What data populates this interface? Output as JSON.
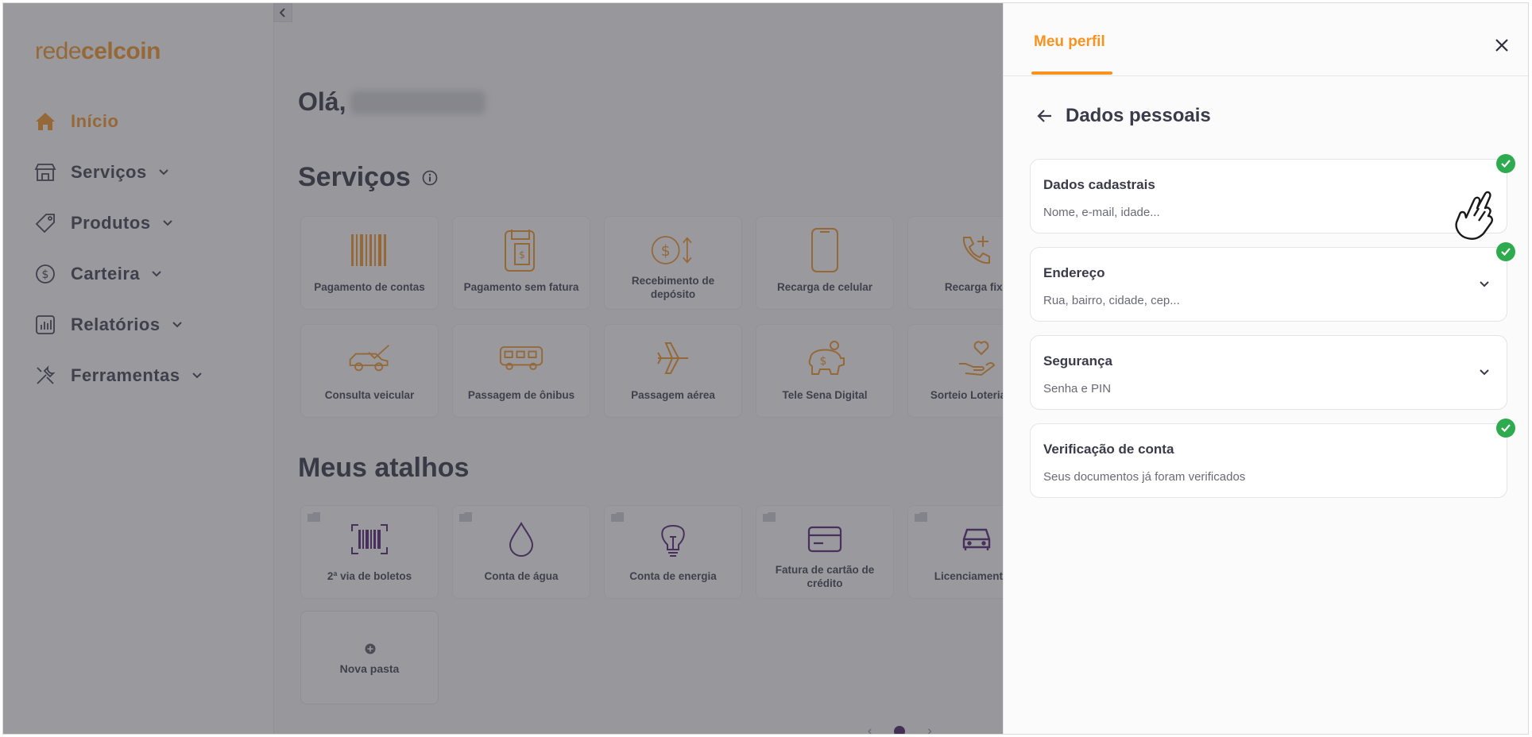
{
  "brand": {
    "logo_light": "rede",
    "logo_bold": "celcoin",
    "accent": "#f7931e"
  },
  "sidebar": {
    "items": [
      {
        "label": "Início",
        "icon": "home-icon",
        "active": true
      },
      {
        "label": "Serviços",
        "icon": "store-icon",
        "expandable": true
      },
      {
        "label": "Produtos",
        "icon": "tag-icon",
        "expandable": true
      },
      {
        "label": "Carteira",
        "icon": "dollar-circle-icon",
        "expandable": true
      },
      {
        "label": "Relatórios",
        "icon": "chart-icon",
        "expandable": true
      },
      {
        "label": "Ferramentas",
        "icon": "tools-icon",
        "expandable": true
      }
    ]
  },
  "main": {
    "greeting": "Olá,",
    "services_title": "Serviços",
    "services": [
      {
        "label": "Pagamento de contas",
        "icon": "barcode-icon"
      },
      {
        "label": "Pagamento sem fatura",
        "icon": "invoice-icon"
      },
      {
        "label": "Recebimento de depósito",
        "icon": "deposit-icon"
      },
      {
        "label": "Recarga de celular",
        "icon": "phone-icon"
      },
      {
        "label": "Recarga fixa",
        "icon": "phone-plus-icon"
      },
      {
        "label": "Consulta veicular",
        "icon": "car-check-icon"
      },
      {
        "label": "Passagem de ônibus",
        "icon": "bus-icon"
      },
      {
        "label": "Passagem aérea",
        "icon": "plane-icon"
      },
      {
        "label": "Tele Sena Digital",
        "icon": "piggy-bank-icon"
      },
      {
        "label": "Sorteio Loteria/Dê",
        "icon": "heart-hand-icon"
      }
    ],
    "shortcuts_title": "Meus atalhos",
    "shortcuts": [
      {
        "label": "2ª via de boletos",
        "icon": "barcode-scan-icon"
      },
      {
        "label": "Conta de água",
        "icon": "water-drop-icon"
      },
      {
        "label": "Conta de energia",
        "icon": "lightbulb-icon"
      },
      {
        "label": "Fatura de cartão de crédito",
        "icon": "credit-card-icon"
      },
      {
        "label": "Licenciamento d",
        "icon": "car-icon"
      }
    ],
    "new_folder": "Nova pasta"
  },
  "panel": {
    "tab": "Meu perfil",
    "title": "Dados pessoais",
    "sections": [
      {
        "title": "Dados cadastrais",
        "subtitle": "Nome, e-mail, idade...",
        "verified": true,
        "has_chevron": false
      },
      {
        "title": "Endereço",
        "subtitle": "Rua, bairro, cidade, cep...",
        "verified": true,
        "has_chevron": true
      },
      {
        "title": "Segurança",
        "subtitle": "Senha e PIN",
        "verified": false,
        "has_chevron": true
      },
      {
        "title": "Verificação de conta",
        "subtitle": "Seus documentos já foram verificados",
        "verified": true,
        "has_chevron": false
      }
    ]
  },
  "colors": {
    "success": "#2fab4f",
    "shortcut_icon": "#4a1a6e",
    "text": "#3a3a4a"
  }
}
